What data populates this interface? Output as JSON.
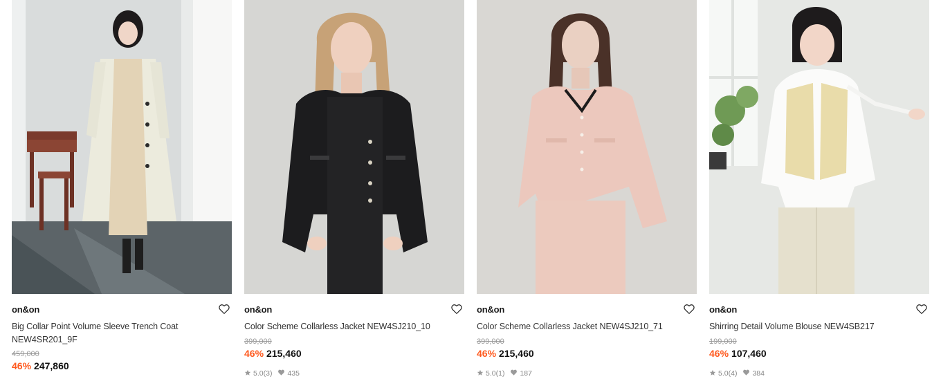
{
  "products": [
    {
      "brand": "on&on",
      "name": "Big Collar Point Volume Sleeve Trench Coat NEW4SR201_9F",
      "original_price": "459,000",
      "discount": "46%",
      "price": "247,860",
      "rating": "",
      "reviews": "",
      "likes": "",
      "image_alt": "Model wearing long cream trench coat in a room with wooden table"
    },
    {
      "brand": "on&on",
      "name": "Color Scheme Collarless Jacket NEW4SJ210_10",
      "original_price": "399,000",
      "discount": "46%",
      "price": "215,460",
      "rating": "5.0",
      "reviews": "(3)",
      "likes": "435",
      "image_alt": "Model wearing black tweed collarless jacket"
    },
    {
      "brand": "on&on",
      "name": "Color Scheme Collarless Jacket NEW4SJ210_71",
      "original_price": "399,000",
      "discount": "46%",
      "price": "215,460",
      "rating": "5.0",
      "reviews": "(1)",
      "likes": "187",
      "image_alt": "Model wearing pink tweed collarless jacket and skirt"
    },
    {
      "brand": "on&on",
      "name": "Shirring Detail Volume Blouse NEW4SB217",
      "original_price": "199,000",
      "discount": "46%",
      "price": "107,460",
      "rating": "5.0",
      "reviews": "(4)",
      "likes": "384",
      "image_alt": "Model wearing white volume blouse with knit vest"
    }
  ],
  "colors": {
    "discount": "#ff5a1f",
    "price": "#111111",
    "muted": "#888888"
  },
  "icons": {
    "wishlist": "heart-outline-icon",
    "rating": "star-icon",
    "likes": "heart-filled-icon"
  }
}
